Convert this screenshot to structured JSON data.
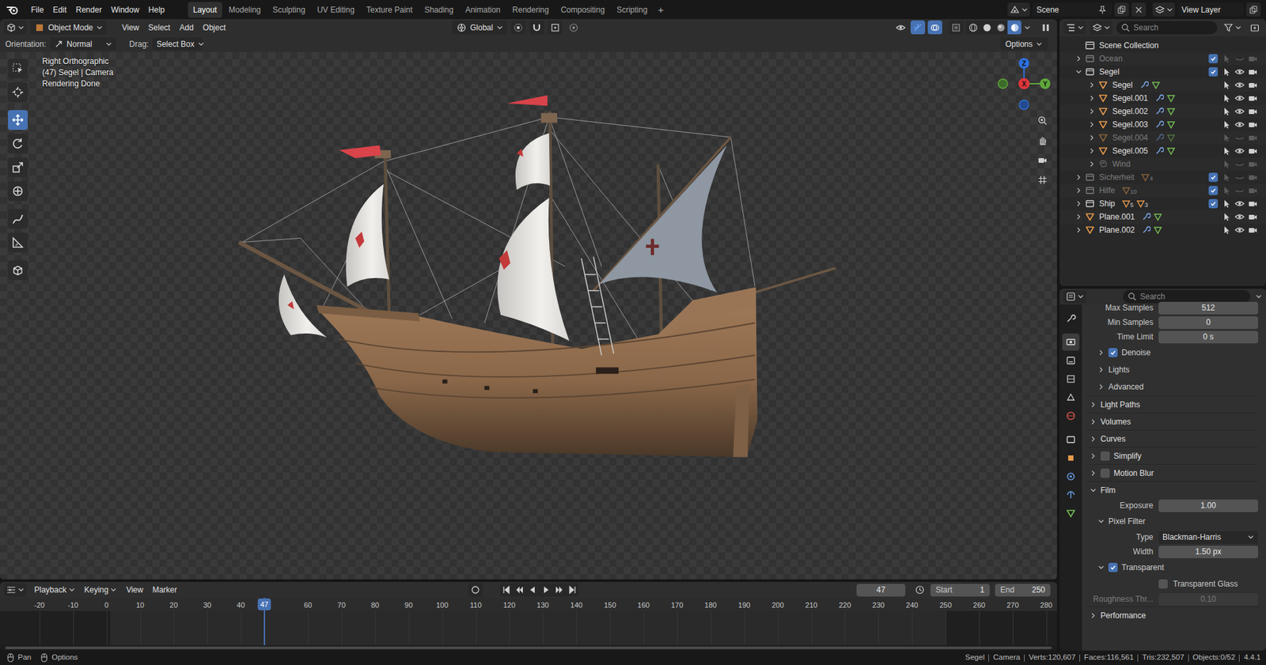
{
  "menu": [
    "File",
    "Edit",
    "Render",
    "Window",
    "Help"
  ],
  "workspaces": [
    {
      "label": "Layout",
      "selected": true
    },
    {
      "label": "Modeling",
      "selected": false
    },
    {
      "label": "Sculpting",
      "selected": false
    },
    {
      "label": "UV Editing",
      "selected": false
    },
    {
      "label": "Texture Paint",
      "selected": false
    },
    {
      "label": "Shading",
      "selected": false
    },
    {
      "label": "Animation",
      "selected": false
    },
    {
      "label": "Rendering",
      "selected": false
    },
    {
      "label": "Compositing",
      "selected": false
    },
    {
      "label": "Scripting",
      "selected": false
    }
  ],
  "add_workspace": "+",
  "scene": "Scene",
  "view_layer": "View Layer",
  "viewport": {
    "mode": "Object Mode",
    "menus": [
      "View",
      "Select",
      "Add",
      "Object"
    ],
    "orientation": "Global",
    "shading_modes": [
      {
        "selected": false
      },
      {
        "selected": false
      },
      {
        "selected": false
      },
      {
        "selected": true
      }
    ],
    "tool_settings": {
      "orientation_label": "Orientation:",
      "orientation": "Normal",
      "drag_label": "Drag:",
      "drag": "Select Box",
      "options": "Options"
    },
    "tools": [
      {
        "selected": false
      },
      {
        "selected": false
      },
      {
        "selected": true
      },
      {
        "selected": false
      },
      {
        "selected": false
      },
      {
        "selected": false
      },
      {
        "selected": false
      },
      {
        "selected": false
      },
      {
        "selected": false
      }
    ],
    "overlay": [
      "Right Orthographic",
      "(47) Segel | Camera",
      "Rendering Done"
    ],
    "gizmo": {
      "z": "Z",
      "x": "X",
      "y": "Y"
    }
  },
  "outliner": {
    "search_placeholder": "Search",
    "root": {
      "label": "Scene Collection",
      "children": [
        {
          "label": "Ocean",
          "kind": "collection",
          "expanded": false,
          "checked": true,
          "disabled": true
        },
        {
          "label": "Segel",
          "kind": "collection",
          "expanded": true,
          "checked": true,
          "disabled": false,
          "children": [
            {
              "label": "Segel",
              "kind": "object",
              "expanded": false,
              "disabled": false
            },
            {
              "label": "Segel.001",
              "kind": "object",
              "expanded": false,
              "disabled": false
            },
            {
              "label": "Segel.002",
              "kind": "object",
              "expanded": false,
              "disabled": false
            },
            {
              "label": "Segel.003",
              "kind": "object",
              "expanded": false,
              "disabled": false
            },
            {
              "label": "Segel.004",
              "kind": "object",
              "expanded": false,
              "disabled": true
            },
            {
              "label": "Segel.005",
              "kind": "object",
              "expanded": false,
              "disabled": false
            },
            {
              "label": "Wind",
              "kind": "empty",
              "expanded": false,
              "disabled": true
            }
          ]
        },
        {
          "label": "Sicherheit",
          "kind": "collection",
          "expanded": false,
          "checked": true,
          "disabled": true,
          "badges": [
            "4"
          ]
        },
        {
          "label": "Hilfe",
          "kind": "collection",
          "expanded": false,
          "checked": true,
          "disabled": true,
          "badges": [
            "10"
          ]
        },
        {
          "label": "Ship",
          "kind": "collection",
          "expanded": false,
          "checked": true,
          "disabled": false,
          "badges": [
            "5",
            "3"
          ]
        },
        {
          "label": "Plane.001",
          "kind": "object",
          "expanded": false,
          "disabled": false
        },
        {
          "label": "Plane.002",
          "kind": "object",
          "expanded": false,
          "disabled": false
        }
      ]
    }
  },
  "properties": {
    "search_placeholder": "Search",
    "tabs": [
      {
        "selected": false
      },
      {
        "selected": true
      },
      {
        "selected": false
      },
      {
        "selected": false
      },
      {
        "selected": false
      },
      {
        "selected": false
      },
      {
        "selected": false
      },
      {
        "selected": false
      },
      {
        "selected": false
      },
      {
        "selected": false
      },
      {
        "selected": false
      }
    ],
    "rows": [
      {
        "kind": "field",
        "label": "Max Samples",
        "value": "512",
        "disabled": false
      },
      {
        "kind": "field",
        "label": "Min Samples",
        "value": "0",
        "disabled": false
      },
      {
        "kind": "field",
        "label": "Time Limit",
        "value": "0 s",
        "disabled": false
      },
      {
        "kind": "subpanel",
        "label": "Denoise",
        "expanded": false,
        "checked": true
      },
      {
        "kind": "subpanel",
        "label": "Lights",
        "expanded": false
      },
      {
        "kind": "subpanel",
        "label": "Advanced",
        "expanded": false
      },
      {
        "kind": "panel",
        "label": "Light Paths",
        "expanded": false
      },
      {
        "kind": "panel",
        "label": "Volumes",
        "expanded": false
      },
      {
        "kind": "panel",
        "label": "Curves",
        "expanded": false
      },
      {
        "kind": "panel",
        "label": "Simplify",
        "expanded": false,
        "checked": false
      },
      {
        "kind": "panel",
        "label": "Motion Blur",
        "expanded": false,
        "checked": false
      },
      {
        "kind": "panel",
        "label": "Film",
        "expanded": true
      },
      {
        "kind": "field",
        "label": "Exposure",
        "value": "1.00",
        "disabled": false
      },
      {
        "kind": "subpanel",
        "label": "Pixel Filter",
        "expanded": true
      },
      {
        "kind": "dropdown",
        "label": "Type",
        "value": "Blackman-Harris"
      },
      {
        "kind": "field",
        "label": "Width",
        "value": "1.50 px",
        "disabled": false
      },
      {
        "kind": "subpanel",
        "label": "Transparent",
        "expanded": true,
        "checked": true
      },
      {
        "kind": "checkbox",
        "label": "Transparent Glass",
        "checked": false
      },
      {
        "kind": "field",
        "label": "Roughness Thr...",
        "value": "0.10",
        "disabled": true
      },
      {
        "kind": "panel",
        "label": "Performance",
        "expanded": false
      }
    ]
  },
  "timeline": {
    "menus": [
      "Playback",
      "Keying",
      "View",
      "Marker"
    ],
    "current_frame": "47",
    "start_label": "Start",
    "start": "1",
    "end_label": "End",
    "end": "250",
    "ruler": [
      "-20",
      "-10",
      "0",
      "10",
      "20",
      "30",
      "40",
      "60",
      "70",
      "80",
      "90",
      "100",
      "110",
      "120",
      "130",
      "140",
      "150",
      "160",
      "170",
      "180",
      "190",
      "200",
      "210",
      "220",
      "230",
      "240",
      "250",
      "260",
      "270",
      "280"
    ]
  },
  "status_bar": {
    "hints": [
      "Pan",
      "Options"
    ],
    "stats": [
      "Segel",
      "Camera",
      "Verts:120,607",
      "Faces:116,561",
      "Tris:232,507",
      "Objects:0/52",
      "4.4.1"
    ]
  }
}
